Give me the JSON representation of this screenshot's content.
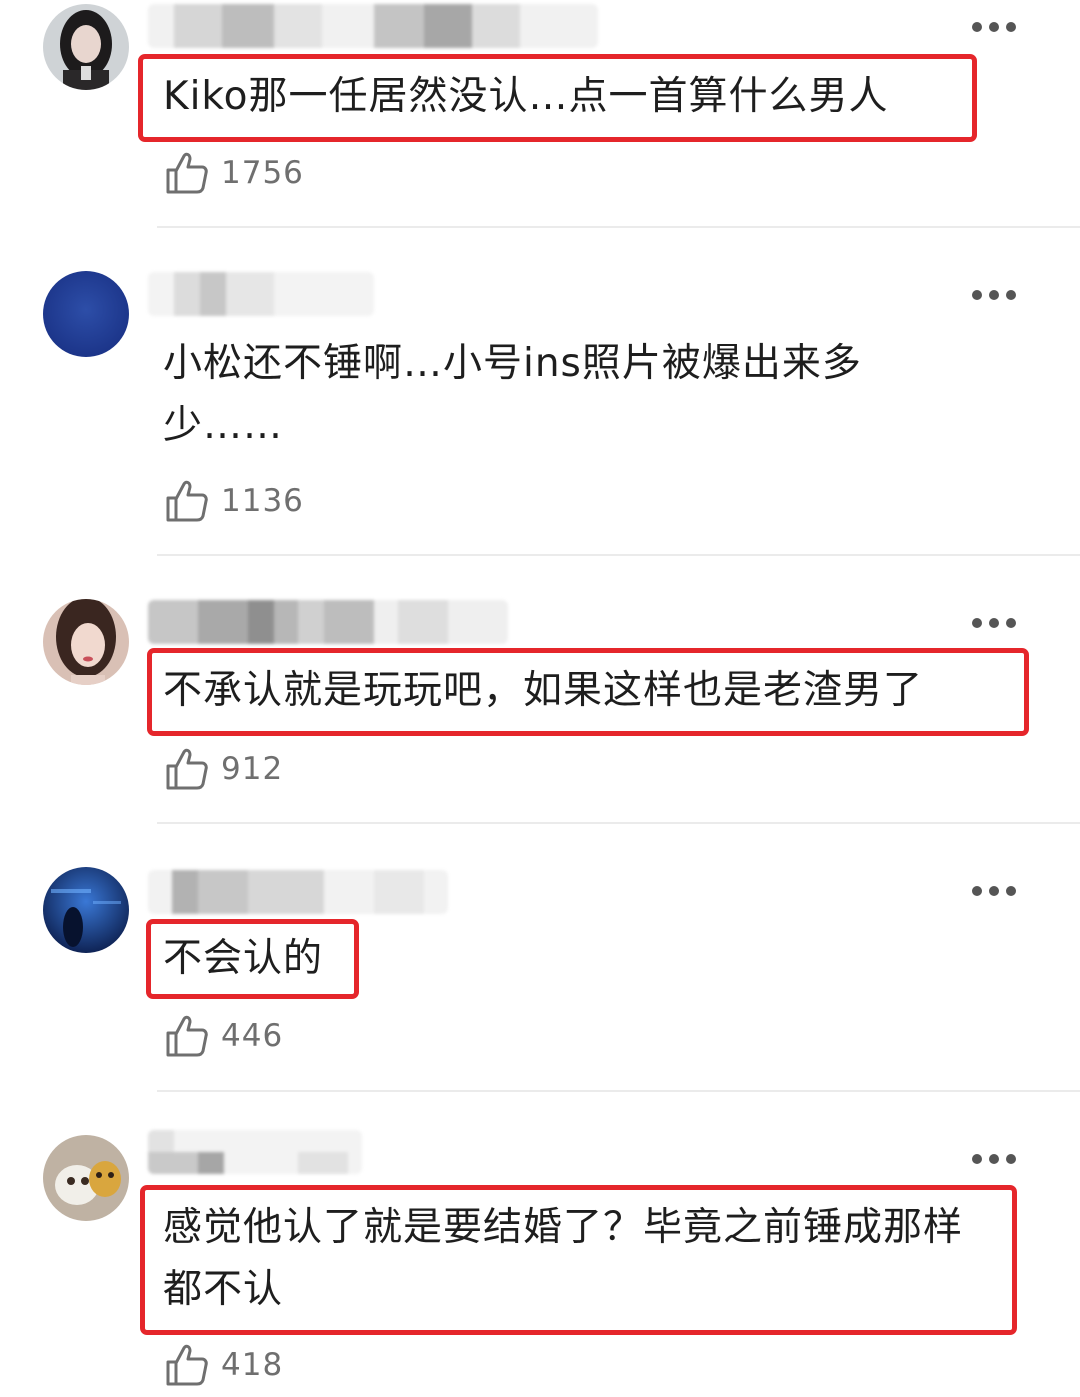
{
  "comments": [
    {
      "text": "Kiko那一任居然没认…点一首算什么男人",
      "likes": "1756",
      "highlighted": true
    },
    {
      "text": "小松还不锤啊…小号ins照片被爆出来多少……",
      "likes": "1136",
      "highlighted": false
    },
    {
      "text": "不承认就是玩玩吧，如果这样也是老渣男了",
      "likes": "912",
      "highlighted": true
    },
    {
      "text": "不会认的",
      "likes": "446",
      "highlighted": true
    },
    {
      "text": "感觉他认了就是要结婚了？毕竟之前锤成那样都不认",
      "likes": "418",
      "highlighted": true
    }
  ],
  "colors": {
    "highlight_box": "#e5262b",
    "like_count": "#6f6f6f",
    "divider": "#ebebeb"
  },
  "icons": {
    "like": "thumbs-up-icon",
    "more": "more-dots-icon"
  }
}
